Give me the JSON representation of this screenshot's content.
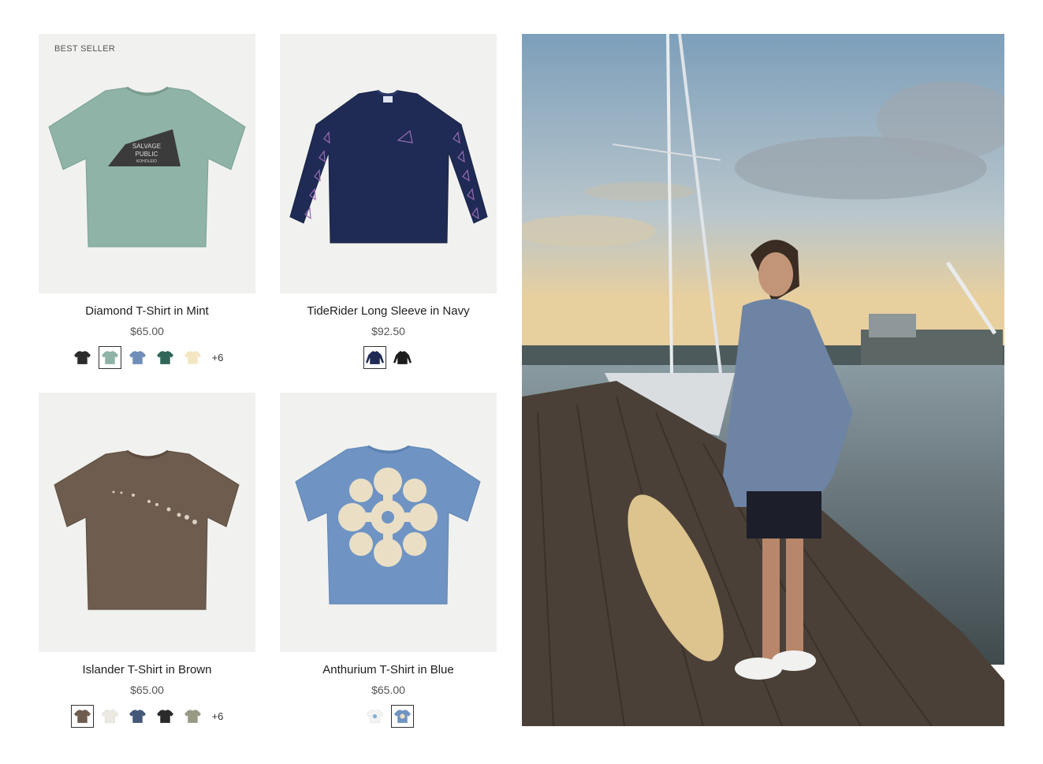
{
  "products": [
    {
      "badge": "BEST SELLER",
      "title": "Diamond T-Shirt in Mint",
      "price": "$65.00",
      "image_icon": "tshirt-icon",
      "image_color": "#8fb3a6",
      "print_text": [
        "SALVAGE",
        "PUBLIC",
        "KOHOLEIO"
      ],
      "swatches": [
        {
          "name": "black",
          "color": "#2b2b2b",
          "selected": false
        },
        {
          "name": "mint",
          "color": "#8fb3a6",
          "selected": true
        },
        {
          "name": "blue",
          "color": "#6f8db9",
          "selected": false
        },
        {
          "name": "green",
          "color": "#2f6657",
          "selected": false
        },
        {
          "name": "cream",
          "color": "#f4e6c2",
          "selected": false
        }
      ],
      "more": "+6"
    },
    {
      "badge": "",
      "title": "TideRider Long Sleeve in Navy",
      "price": "$92.50",
      "image_icon": "longsleeve-icon",
      "image_color": "#1f2b55",
      "swatches": [
        {
          "name": "navy",
          "color": "#1f2b55",
          "selected": true
        },
        {
          "name": "black",
          "color": "#1d1d1d",
          "selected": false
        }
      ],
      "more": ""
    },
    {
      "badge": "",
      "title": "Islander T-Shirt in Brown",
      "price": "$65.00",
      "image_icon": "tshirt-icon",
      "image_color": "#6e5c4e",
      "swatches": [
        {
          "name": "brown",
          "color": "#6e5c4e",
          "selected": true
        },
        {
          "name": "white",
          "color": "#f2f0ea",
          "selected": false
        },
        {
          "name": "navy",
          "color": "#44587a",
          "selected": false
        },
        {
          "name": "black",
          "color": "#2a2a2a",
          "selected": false
        },
        {
          "name": "sage",
          "color": "#999a86",
          "selected": false
        }
      ],
      "more": "+6"
    },
    {
      "badge": "",
      "title": "Anthurium T-Shirt in Blue",
      "price": "$65.00",
      "image_icon": "tshirt-icon",
      "image_color": "#6f94c4",
      "swatches": [
        {
          "name": "white",
          "color": "#f3f3f1",
          "selected": false
        },
        {
          "name": "blue",
          "color": "#6f94c4",
          "selected": true
        }
      ],
      "more": ""
    }
  ],
  "lifestyle_photo": {
    "icon": "lifestyle-photo",
    "sky_color": "#9fb7c8",
    "dock_color": "#4a4037"
  }
}
